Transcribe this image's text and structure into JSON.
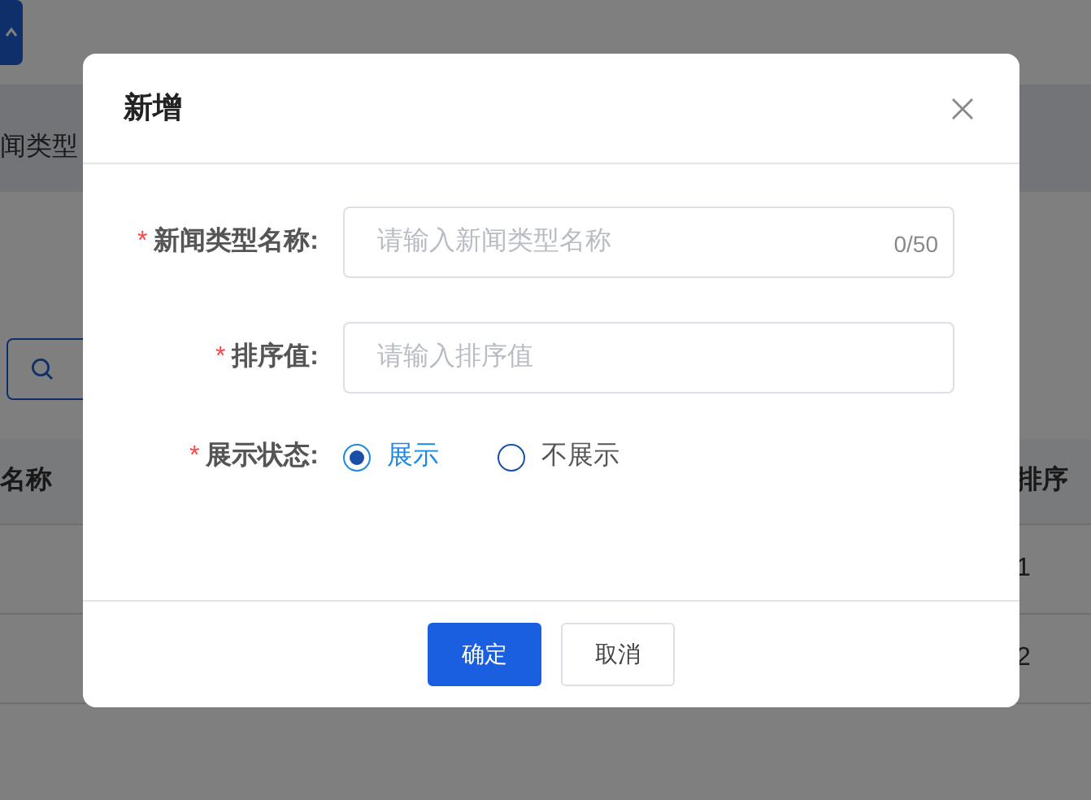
{
  "background": {
    "filter_label": "闻类型",
    "table": {
      "columns": [
        "名称",
        "排序"
      ],
      "rows": [
        {
          "sort": "1"
        },
        {
          "sort": "2"
        }
      ]
    }
  },
  "modal": {
    "title": "新增",
    "fields": [
      {
        "kind": "text",
        "required_mark": "*",
        "label": "新闻类型名称:",
        "placeholder": "请输入新闻类型名称",
        "counter": "0/50"
      },
      {
        "kind": "text",
        "required_mark": "*",
        "label": "排序值:",
        "placeholder": "请输入排序值"
      },
      {
        "kind": "radio",
        "required_mark": "*",
        "label": "展示状态:",
        "options": [
          {
            "label": "展示",
            "selected": true
          },
          {
            "label": "不展示",
            "selected": false
          }
        ]
      }
    ],
    "buttons": [
      {
        "label": "确定",
        "kind": "primary"
      },
      {
        "label": "取消",
        "kind": "default"
      }
    ]
  }
}
